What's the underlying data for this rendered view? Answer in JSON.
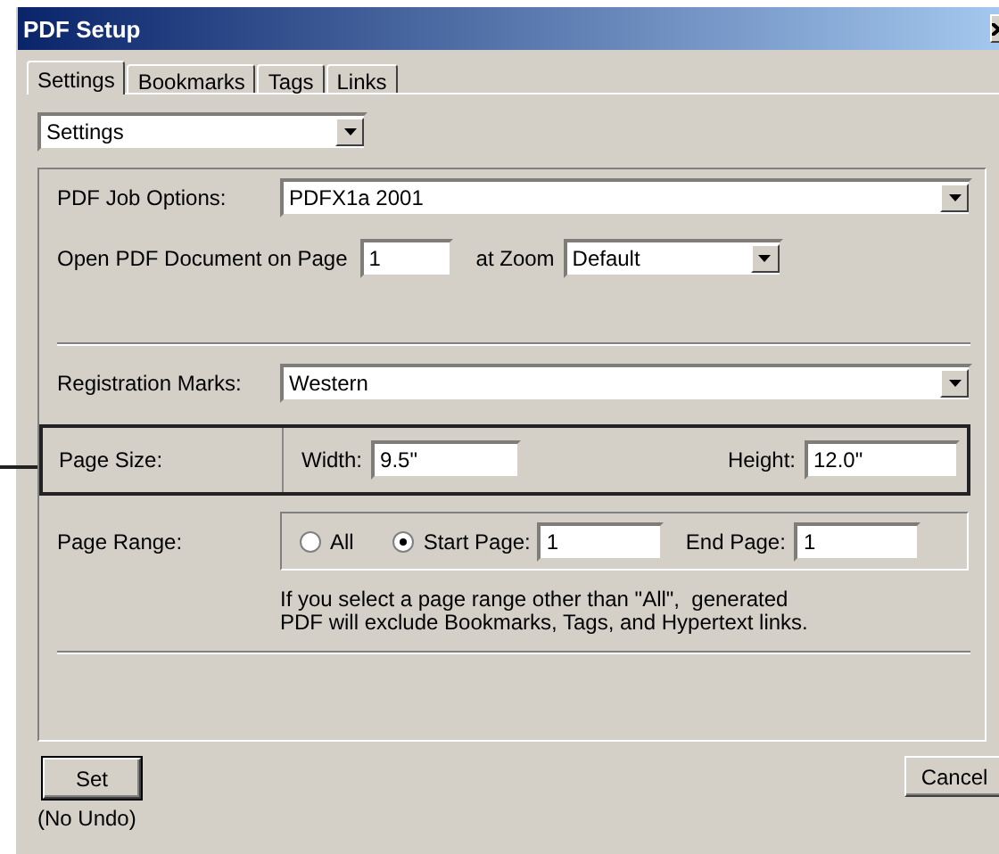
{
  "window": {
    "title": "PDF Setup"
  },
  "tabs": [
    {
      "label": "Settings",
      "selected": true
    },
    {
      "label": "Bookmarks",
      "selected": false
    },
    {
      "label": "Tags",
      "selected": false
    },
    {
      "label": "Links",
      "selected": false
    }
  ],
  "section_dropdown": {
    "value": "Settings"
  },
  "job_options": {
    "label": "PDF Job Options:",
    "value": "PDFX1a 2001"
  },
  "open_page": {
    "label": "Open PDF Document on Page",
    "value": "1",
    "zoom_label": "at Zoom",
    "zoom_value": "Default"
  },
  "registration": {
    "label": "Registration Marks:",
    "value": "Western"
  },
  "page_size": {
    "label": "Page Size:",
    "width_label": "Width:",
    "width_value": "9.5\"",
    "height_label": "Height:",
    "height_value": "12.0\"",
    "highlighted": true
  },
  "page_range": {
    "label": "Page Range:",
    "options": [
      {
        "label": "All",
        "selected": false
      },
      {
        "label": "Start Page:",
        "selected": true
      }
    ],
    "start_value": "1",
    "end_label": "End Page:",
    "end_value": "1",
    "note": "If you select a page range other than \"All\",  generated\nPDF will exclude Bookmarks, Tags, and Hypertext links."
  },
  "set_button": {
    "label": "Set",
    "note": "(No Undo)"
  },
  "cancel_button": {
    "label": "Cancel"
  }
}
